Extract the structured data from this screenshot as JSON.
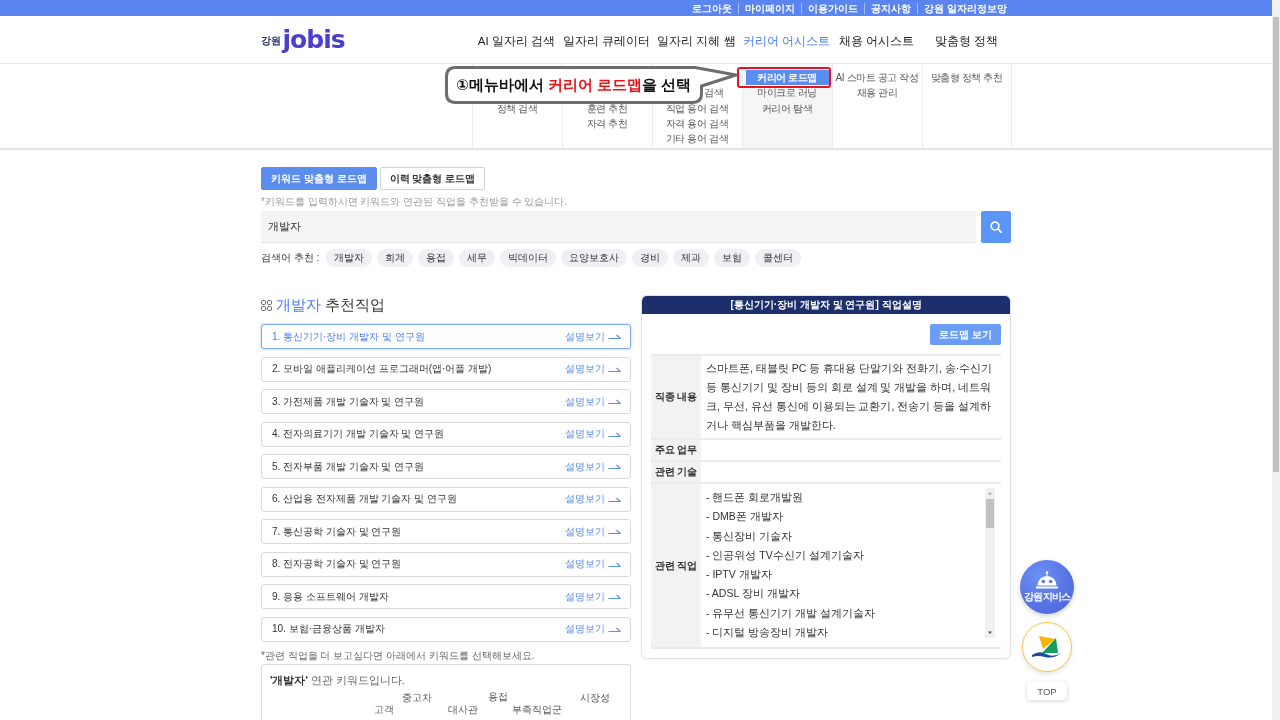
{
  "top_bar": {
    "links": [
      "로그아웃",
      "마이페이지",
      "이용가이드",
      "공지사항",
      "강원 일자리정보망"
    ]
  },
  "header": {
    "logo": {
      "region": "강원",
      "name": "jobis"
    },
    "nav": [
      {
        "label": "AI 일자리 검색",
        "selected": false
      },
      {
        "label": "일자리 큐레이터",
        "selected": false
      },
      {
        "label": "일자리 지혜 쌤",
        "selected": false
      },
      {
        "label": "커리어 어시스트",
        "selected": true
      },
      {
        "label": "채용 어시스트",
        "selected": false
      },
      {
        "label": "맞춤형 정책",
        "selected": false
      }
    ]
  },
  "mega_menu": {
    "columns": [
      {
        "covered": true,
        "items": [
          {
            "label": "정책 검색",
            "kind": "full",
            "selected": false
          }
        ]
      },
      {
        "covered": true,
        "items": [
          {
            "label": "훈련 추천",
            "kind": "full",
            "selected": false
          },
          {
            "label": "자격 추천",
            "kind": "full",
            "selected": false
          }
        ]
      },
      {
        "covered": true,
        "items": [
          {
            "label": "검색",
            "kind": "partial",
            "selected": false
          },
          {
            "label": "직업 용어 검색",
            "kind": "full",
            "selected": false
          },
          {
            "label": "자격 용어 검색",
            "kind": "full",
            "selected": false
          },
          {
            "label": "기타 용어 검색",
            "kind": "full",
            "selected": false
          }
        ]
      },
      {
        "covered": false,
        "items": [
          {
            "label": "커리어 로드맵",
            "kind": "full",
            "selected": true
          },
          {
            "label": "마이크로 러닝",
            "kind": "full",
            "selected": false
          },
          {
            "label": "커리어 탐색",
            "kind": "full",
            "selected": false
          }
        ]
      },
      {
        "covered": false,
        "items": [
          {
            "label": "AI 스마트 공고 작성",
            "kind": "full",
            "selected": false
          },
          {
            "label": "채용 관리",
            "kind": "full",
            "selected": false
          }
        ]
      },
      {
        "covered": false,
        "items": [
          {
            "label": "맞춤형 정책 추천",
            "kind": "full",
            "selected": false
          }
        ]
      }
    ]
  },
  "callout": {
    "parts": [
      {
        "text": "①메뉴바에서 ",
        "emphasis": false
      },
      {
        "text": "커리어 로드맵",
        "emphasis": true
      },
      {
        "text": "을 선택",
        "emphasis": false
      }
    ]
  },
  "roadmap_tabs": [
    {
      "label": "키워드 맞춤형 로드맵",
      "selected": true
    },
    {
      "label": "이력 맞춤형 로드맵",
      "selected": false
    }
  ],
  "search": {
    "hint": "*키워드를 입력하시면 키워드와 연관된 직업을 추천받을 수 있습니다.",
    "value": "개발자",
    "suggest_label": "검색어 추천 :",
    "suggestions": [
      "개발자",
      "회계",
      "용접",
      "세무",
      "빅데이터",
      "요양보호사",
      "경비",
      "제과",
      "보험",
      "콜센터"
    ]
  },
  "results": {
    "keyword": "개발자",
    "title_suffix": "추천직업",
    "jobs": [
      {
        "title": "1. 통신기기·장비 개발자 및 연구원",
        "link": "설명보기",
        "selected": true
      },
      {
        "title": "2. 모바일 애플리케이션 프로그래머(앱·어플 개발)",
        "link": "설명보기",
        "selected": false
      },
      {
        "title": "3. 가전제품 개발 기술자 및 연구원",
        "link": "설명보기",
        "selected": false
      },
      {
        "title": "4. 전자의료기기 개발 기술자 및 연구원",
        "link": "설명보기",
        "selected": false
      },
      {
        "title": "5. 전자부품 개발 기술자 및 연구원",
        "link": "설명보기",
        "selected": false
      },
      {
        "title": "6. 산업용 전자제품 개발 기술자 및 연구원",
        "link": "설명보기",
        "selected": false
      },
      {
        "title": "7. 통신공학 기술자 및 연구원",
        "link": "설명보기",
        "selected": false
      },
      {
        "title": "8. 전자공학 기술자 및 연구원",
        "link": "설명보기",
        "selected": false
      },
      {
        "title": "9. 응용 소프트웨어 개발자",
        "link": "설명보기",
        "selected": false
      },
      {
        "title": "10. 보험·금융상품 개발자",
        "link": "설명보기",
        "selected": false
      }
    ],
    "more_hint": "*관련 직업을 더 보고싶다면 아래에서 키워드를 선택해보세요.",
    "keyword_intro": "**'개발자'** 연관 키워드입니다.",
    "keyword_cloud": [
      "고객",
      "중고차",
      "대사관",
      "용접",
      "부족직업군",
      "시장성"
    ]
  },
  "detail": {
    "title": "[통신기기·장비 개발자 및 연구원] 직업설명",
    "button": "로드맵 보기",
    "rows": [
      {
        "label": "직종 내용",
        "kind": "text",
        "text": "스마트폰, 태블릿 PC 등 휴대용 단말기와 전화기, 송·수신기 등 통신기기 및 장비 등의 회로 설계 및 개발을 하며, 네트워크, 무선, 유선 통신에 이용되는 교환기, 전송기 등을 설계하거나 핵심부품을 개발한다."
      },
      {
        "label": "주요 업무",
        "kind": "text"
      },
      {
        "label": "관련 기술",
        "kind": "text"
      },
      {
        "label": "관련 직업",
        "kind": "list",
        "items": [
          "- 핸드폰 회로개발원",
          "- DMB폰 개발자",
          "- 통신장비 기술자",
          "- 인공위성 TV수신기 설계기술자",
          "- IPTV 개발자",
          "- ADSL 장비 개발자",
          "- 유무선 통신기기 개발 설계기술자",
          "- 디지털 방송장비 개발자"
        ]
      }
    ]
  },
  "floating": {
    "assistant_label": "강원 지비스",
    "top_label": "TOP"
  }
}
